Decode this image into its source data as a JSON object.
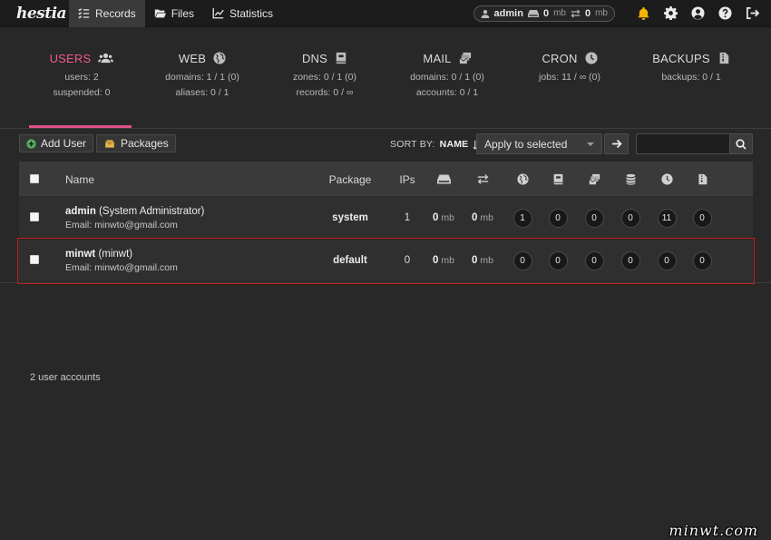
{
  "app": {
    "logo": "hestia"
  },
  "nav": {
    "records": "Records",
    "files": "Files",
    "statistics": "Statistics"
  },
  "user_pill": {
    "user": "admin",
    "disk_value": "0",
    "disk_unit": "mb",
    "bandwidth_value": "0",
    "bandwidth_unit": "mb"
  },
  "stats": [
    {
      "title": "USERS",
      "line1": "users: 2",
      "line2": "suspended: 0",
      "icon": "users-icon"
    },
    {
      "title": "WEB",
      "line1": "domains: 1 / 1 (0)",
      "line2": "aliases: 0 / 1",
      "icon": "globe-icon"
    },
    {
      "title": "DNS",
      "line1": "zones: 0 / 1 (0)",
      "line2": "records: 0 / ∞",
      "icon": "book-icon"
    },
    {
      "title": "MAIL",
      "line1": "domains: 0 / 1 (0)",
      "line2": "accounts: 0 / 1",
      "icon": "mail-icon"
    },
    {
      "title": "CRON",
      "line1": "jobs: 11 / ∞ (0)",
      "line2": "",
      "icon": "clock-icon"
    },
    {
      "title": "BACKUPS",
      "line1": "backups: 0 / 1",
      "line2": "",
      "icon": "file-icon"
    }
  ],
  "toolbar": {
    "add_user": "Add User",
    "packages": "Packages",
    "sort_by": "SORT BY:",
    "sort_field": "NAME",
    "bulk_select": "Apply to selected",
    "search_value": ""
  },
  "table": {
    "headers": {
      "name": "Name",
      "package": "Package",
      "ips": "IPs"
    },
    "rows": [
      {
        "username": "admin",
        "fullname": "(System Administrator)",
        "email_label": "Email:",
        "email": "minwto@gmail.com",
        "package": "system",
        "ips": "1",
        "disk": "0",
        "disk_unit": "mb",
        "bandwidth": "0",
        "bandwidth_unit": "mb",
        "web": "1",
        "dns": "0",
        "mail": "0",
        "db": "0",
        "cron": "11",
        "backups": "0"
      },
      {
        "username": "minwt",
        "fullname": "(minwt)",
        "email_label": "Email:",
        "email": "minwto@gmail.com",
        "package": "default",
        "ips": "0",
        "disk": "0",
        "disk_unit": "mb",
        "bandwidth": "0",
        "bandwidth_unit": "mb",
        "web": "0",
        "dns": "0",
        "mail": "0",
        "db": "0",
        "cron": "0",
        "backups": "0"
      }
    ]
  },
  "footer": {
    "count": "2 user accounts"
  },
  "watermark": "minwt.com",
  "colors": {
    "accent": "#e0508a",
    "highlight": "#c61c1c",
    "background": "#282828"
  }
}
